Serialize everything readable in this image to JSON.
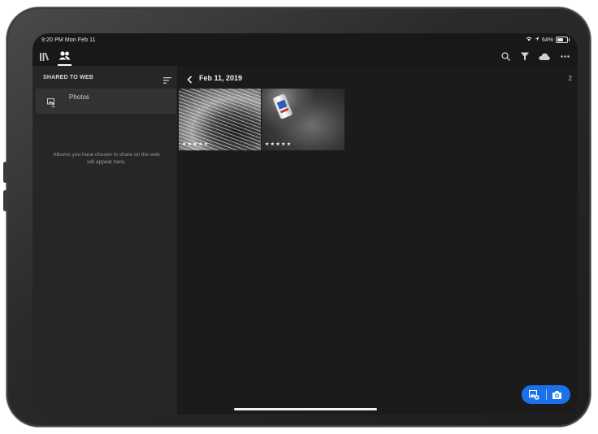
{
  "status_bar": {
    "time": "9:20 PM  Mon Feb 11",
    "battery": "64%"
  },
  "topbar": {
    "left_icons": [
      "library-icon",
      "people-icon"
    ],
    "right_icons": [
      "search-icon",
      "filter-icon",
      "cloud-icon",
      "more-icon"
    ],
    "active_tab": "people"
  },
  "sidebar": {
    "header": "SHARED TO WEB",
    "albums": [
      {
        "name": "Photos",
        "icon": "shared-album-icon"
      }
    ],
    "empty_message": "Albums you have chosen to share on the web will appear here."
  },
  "main": {
    "title": "Feb 11, 2019",
    "count": "2",
    "photos": [
      {
        "rating_stars": "★★★★★",
        "subject": "curved staircase black and white"
      },
      {
        "rating_stars": "★★★★★",
        "subject": "crushed can on ground"
      }
    ]
  },
  "fab": {
    "actions": [
      "add-photos-icon",
      "camera-icon"
    ],
    "color": "#1b72e8"
  },
  "colors": {
    "sidebar_bg": "#262626",
    "main_bg": "#1b1b1b",
    "accent": "#1b72e8"
  }
}
